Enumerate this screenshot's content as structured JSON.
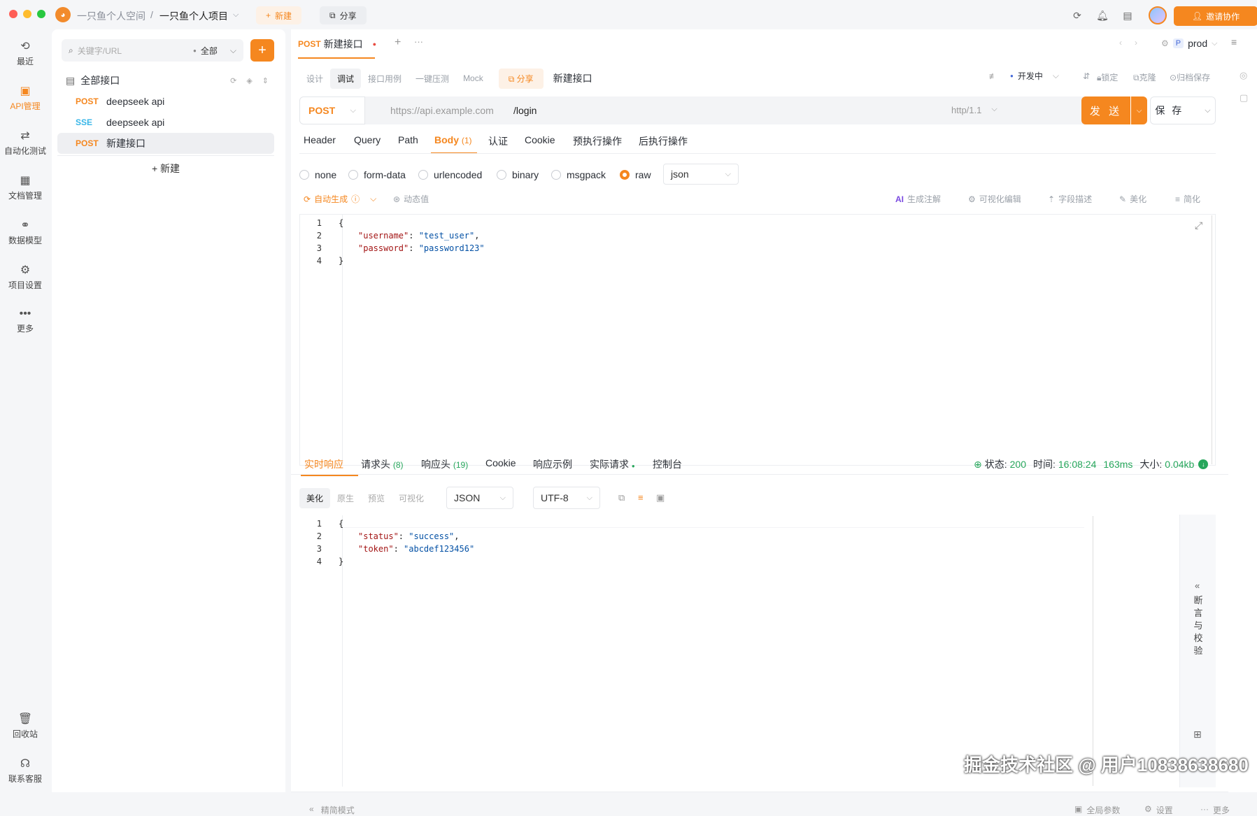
{
  "titlebar": {
    "workspace": "一只鱼个人空间",
    "separator": "/",
    "project": "一只鱼个人项目",
    "new_label": "新建",
    "share_label": "分享",
    "invite_label": "邀请协作"
  },
  "rail": {
    "items": [
      {
        "label": "最近",
        "icon": "clock-icon"
      },
      {
        "label": "API管理",
        "icon": "api-icon"
      },
      {
        "label": "自动化测试",
        "icon": "automation-icon"
      },
      {
        "label": "文档管理",
        "icon": "document-icon"
      },
      {
        "label": "数据模型",
        "icon": "data-model-icon"
      },
      {
        "label": "项目设置",
        "icon": "settings-icon"
      },
      {
        "label": "更多",
        "icon": "more-icon"
      }
    ],
    "bottom": [
      {
        "label": "回收站",
        "icon": "trash-icon"
      },
      {
        "label": "联系客服",
        "icon": "headset-icon"
      }
    ]
  },
  "sidebar": {
    "search_placeholder": "关键字/URL",
    "filter_label": "全部",
    "root_label": "全部接口",
    "items": [
      {
        "method": "POST",
        "name": "deepseek api"
      },
      {
        "method": "SSE",
        "name": "deepseek api"
      },
      {
        "method": "POST",
        "name": "新建接口"
      }
    ],
    "new_label": "+ 新建"
  },
  "tabs": {
    "active_method": "POST",
    "active_name": "新建接口",
    "env": "prod",
    "env_prefix": "P"
  },
  "subtabs": {
    "items": [
      "设计",
      "调试",
      "接口用例",
      "一键压测",
      "Mock"
    ],
    "share": "分享",
    "title": "新建接口",
    "status": "开发中",
    "lock": "锁定",
    "clone": "克隆",
    "archive": "归档保存"
  },
  "request": {
    "method": "POST",
    "base_url": "https://api.example.com",
    "path": "/login",
    "protocol": "http/1.1",
    "send_label": "发 送",
    "save_label": "保 存"
  },
  "param_tabs": [
    "Header",
    "Query",
    "Path",
    "Body",
    "认证",
    "Cookie",
    "预执行操作",
    "后执行操作"
  ],
  "body_count": "(1)",
  "body_types": [
    "none",
    "form-data",
    "urlencoded",
    "binary",
    "msgpack",
    "raw"
  ],
  "body_format": "json",
  "body_tools": {
    "auto": "自动生成",
    "dynamic": "动态值",
    "ai_comment": "生成注解",
    "visual_edit": "可视化编辑",
    "field_desc": "字段描述",
    "beautify": "美化",
    "simplify": "简化"
  },
  "body_code": [
    {
      "n": "1",
      "text": "{"
    },
    {
      "n": "2",
      "key": "\"username\"",
      "val": "\"test_user\"",
      "comma": ","
    },
    {
      "n": "3",
      "key": "\"password\"",
      "val": "\"password123\"",
      "comma": ""
    },
    {
      "n": "4",
      "text": "}"
    }
  ],
  "response_tabs": {
    "realtime": "实时响应",
    "req_headers": "请求头",
    "req_headers_count": "(8)",
    "resp_headers": "响应头",
    "resp_headers_count": "(19)",
    "cookie": "Cookie",
    "example": "响应示例",
    "actual": "实际请求",
    "console": "控制台"
  },
  "response_status": {
    "status_label": "状态:",
    "status": "200",
    "time_label": "时间:",
    "time": "16:08:24",
    "duration": "163ms",
    "size_label": "大小:",
    "size": "0.04kb"
  },
  "response_view": {
    "modes": [
      "美化",
      "原生",
      "预览",
      "可视化"
    ],
    "format": "JSON",
    "encoding": "UTF-8"
  },
  "response_code": [
    {
      "n": "1",
      "text": "{"
    },
    {
      "n": "2",
      "key": "\"status\"",
      "val": "\"success\"",
      "comma": ","
    },
    {
      "n": "3",
      "key": "\"token\"",
      "val": "\"abcdef123456\"",
      "comma": ""
    },
    {
      "n": "4",
      "text": "}"
    }
  ],
  "assert_panel": "断言与校验",
  "footer": {
    "compact": "精简模式",
    "global_params": "全局参数",
    "settings": "设置",
    "more": "更多"
  },
  "watermark": "掘金技术社区 @ 用户10838638680",
  "colors": {
    "accent": "#f5871f",
    "post": "#f5871f",
    "sse": "#38b6e8",
    "success": "#26a65b"
  }
}
